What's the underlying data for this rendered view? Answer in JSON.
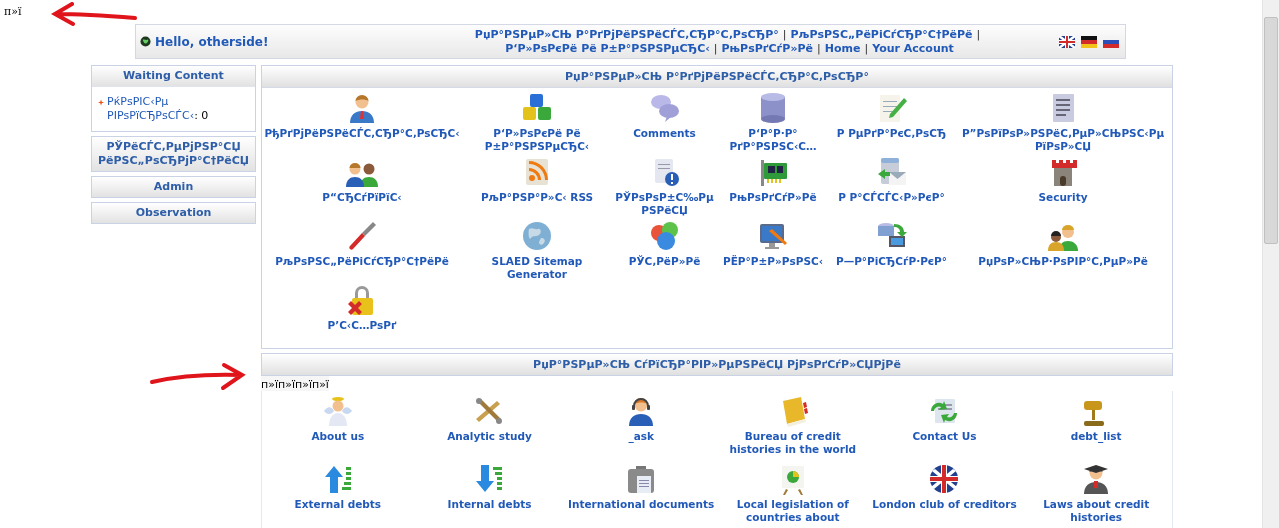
{
  "top_text": "п»ї",
  "header": {
    "greeting": "Hello, otherside!",
    "separator": "|",
    "links": [
      {
        "label": "РџР°РЅРµР»СЊ Р°РґРјРёРЅРёСЃС‚СЂР°С‚РѕСЂР°"
      },
      {
        "label": "РљРѕРЅС„РёРіСѓСЂР°С†РёРё"
      },
      {
        "label": "Р‘Р»РѕРєРё Рё Р±Р°РЅРЅРµСЂС‹"
      },
      {
        "label": "РњРѕРґСѓР»Рё"
      },
      {
        "label": "Home"
      },
      {
        "label": "Your Account"
      }
    ]
  },
  "sidebar": {
    "blocks": [
      {
        "title": "Waiting Content",
        "items": [
          {
            "label": "РќРѕРІС‹Рµ РІРѕРїСЂРѕСЃС‹",
            "separator": ":",
            "count": "0"
          }
        ]
      },
      {
        "title": "РЎРёСЃС‚РµРјРЅР°СЏ РёРЅС„РѕСЂРјР°С†РёСЏ"
      },
      {
        "title": "Admin"
      },
      {
        "title": "Observation"
      }
    ]
  },
  "admin_panel": {
    "title": "РџР°РЅРµР»СЊ Р°РґРјРёРЅРёСЃС‚СЂР°С‚РѕСЂР°",
    "items": [
      {
        "label": "РђРґРјРёРЅРёСЃС‚СЂР°С‚РѕСЂС‹"
      },
      {
        "label": "Р‘Р»РѕРєРё Рё Р±Р°РЅРЅРµСЂС‹"
      },
      {
        "label": "Comments"
      },
      {
        "label": "Р‘Р°Р·Р° РґР°РЅРЅС‹С…"
      },
      {
        "label": "Р РµРґР°РєС‚РѕСЂ"
      },
      {
        "label": "Р”РѕРїРѕР»РЅРёС‚РµР»СЊРЅС‹Рµ РїРѕР»СЏ"
      },
      {
        "label": "Р“СЂСѓРїРїС‹"
      },
      {
        "label": "РљР°РЅР°Р»С‹ RSS"
      },
      {
        "label": "РЎРѕРѕР±С‰РµРЅРёСЏ"
      },
      {
        "label": "РњРѕРґСѓР»Рё"
      },
      {
        "label": "Р Р°СЃСЃС‹Р»РєР°"
      },
      {
        "label": "Security"
      },
      {
        "label": "РљРѕРЅС„РёРіСѓСЂР°С†РёРё"
      },
      {
        "label": "SLAED Sitemap Generator"
      },
      {
        "label": "РЎС‚РёР»Рё"
      },
      {
        "label": "РЁР°Р±Р»РѕРЅС‹"
      },
      {
        "label": "Р—Р°РіСЂСѓР·РєР°"
      },
      {
        "label": "РџРѕР»СЊР·РѕРІР°С‚РµР»Рё"
      },
      {
        "label": "Р’С‹С…РѕРґ"
      }
    ]
  },
  "modules_panel": {
    "title": "РџР°РЅРµР»СЊ СѓРїСЂР°РІР»РµРЅРёСЏ РјРѕРґСѓР»СЏРјРё",
    "stray_text": "п»їп»їп»їп»ї",
    "items": [
      {
        "label": "About us"
      },
      {
        "label": "Analytic study"
      },
      {
        "label": "_ask"
      },
      {
        "label": "Bureau of credit histories in the world"
      },
      {
        "label": "Contact Us"
      },
      {
        "label": "debt_list"
      },
      {
        "label": "External debts"
      },
      {
        "label": "Internal debts"
      },
      {
        "label": "International documents"
      },
      {
        "label": "Local legislation of countries about"
      },
      {
        "label": "London club of creditors"
      },
      {
        "label": "Laws about credit histories"
      }
    ]
  }
}
